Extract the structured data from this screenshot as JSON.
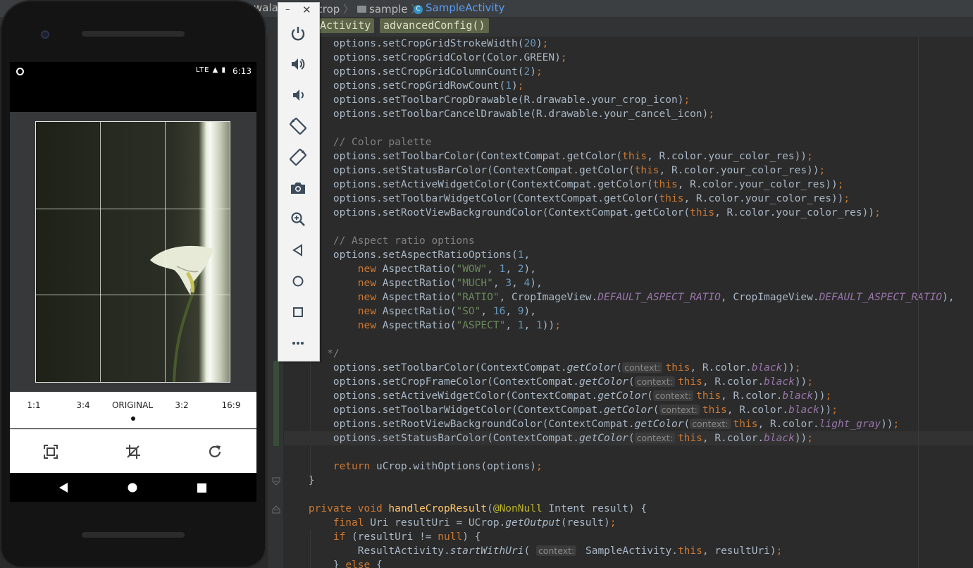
{
  "ide": {
    "breadcrumbs": {
      "path_fragment": "wala",
      "module": "ucrop",
      "folder": "sample",
      "class": "SampleActivity"
    },
    "code_context": {
      "class_chip": "eActivity",
      "method_chip": "advancedConfig()"
    },
    "code_lines": [
      {
        "t": "    options.setCropGridStrokeWidth(20);"
      },
      {
        "t": "    options.setCropGridColor(Color.GREEN);"
      },
      {
        "t": "    options.setCropGridColumnCount(2);"
      },
      {
        "t": "    options.setCropGridRowCount(1);"
      },
      {
        "t": "    options.setToolbarCropDrawable(R.drawable.your_crop_icon);"
      },
      {
        "t": "    options.setToolbarCancelDrawable(R.drawable.your_cancel_icon);"
      },
      {
        "t": ""
      },
      {
        "t": "    // Color palette"
      },
      {
        "t": "    options.setToolbarColor(ContextCompat.getColor(this, R.color.your_color_res));"
      },
      {
        "t": "    options.setStatusBarColor(ContextCompat.getColor(this, R.color.your_color_res));"
      },
      {
        "t": "    options.setActiveWidgetColor(ContextCompat.getColor(this, R.color.your_color_res));"
      },
      {
        "t": "    options.setToolbarWidgetColor(ContextCompat.getColor(this, R.color.your_color_res));"
      },
      {
        "t": "    options.setRootViewBackgroundColor(ContextCompat.getColor(this, R.color.your_color_res));"
      },
      {
        "t": ""
      },
      {
        "t": "    // Aspect ratio options"
      },
      {
        "t": "    options.setAspectRatioOptions(1,"
      },
      {
        "t": "        new AspectRatio(\"WOW\", 1, 2),"
      },
      {
        "t": "        new AspectRatio(\"MUCH\", 3, 4),"
      },
      {
        "t": "        new AspectRatio(\"RATIO\", CropImageView.DEFAULT_ASPECT_RATIO, CropImageView.DEFAULT_ASPECT_RATIO),"
      },
      {
        "t": "        new AspectRatio(\"SO\", 16, 9),"
      },
      {
        "t": "        new AspectRatio(\"ASPECT\", 1, 1));"
      },
      {
        "t": ""
      },
      {
        "t": "   */"
      },
      {
        "pre": "    options.setToolbarColor(ContextCompat.",
        "fn": "getColor",
        "mid": "(",
        "hint": "context:",
        "arg": "this",
        "post": ", R.color.",
        "fld": "black",
        "end": "));"
      },
      {
        "pre": "    options.setCropFrameColor(ContextCompat.",
        "fn": "getColor",
        "mid": "(",
        "hint": "context:",
        "arg": "this",
        "post": ", R.color.",
        "fld": "black",
        "end": "));"
      },
      {
        "pre": "    options.setActiveWidgetColor(ContextCompat.",
        "fn": "getColor",
        "mid": "(",
        "hint": "context:",
        "arg": "this",
        "post": ", R.color.",
        "fld": "black",
        "end": "));"
      },
      {
        "pre": "    options.setToolbarWidgetColor(ContextCompat.",
        "fn": "getColor",
        "mid": "(",
        "hint": "context:",
        "arg": "this",
        "post": ", R.color.",
        "fld": "black",
        "end": "));"
      },
      {
        "pre": "    options.setRootViewBackgroundColor(ContextCompat.",
        "fn": "getColor",
        "mid": "(",
        "hint": "context:",
        "arg": "this",
        "post": ", R.color.",
        "fld": "light_gray",
        "end": "));"
      },
      {
        "pre": "    options.setStatusBarColor(ContextCompat.",
        "fn": "getColor",
        "mid": "(",
        "hint": "context:",
        "arg": "this",
        "post": ", R.color.",
        "fld": "black",
        "end": "));"
      },
      {
        "t": ""
      },
      {
        "t": "    return uCrop.withOptions(options);"
      },
      {
        "t": "}"
      },
      {
        "t": ""
      },
      {
        "t": "private void handleCropResult(@NonNull Intent result) {"
      },
      {
        "t": "    final Uri resultUri = UCrop.getOutput(result);"
      },
      {
        "t": "    if (resultUri != null) {"
      },
      {
        "t": "        ResultActivity.startWithUri( context: SampleActivity.this, resultUri);"
      },
      {
        "t": "    } else {"
      }
    ]
  },
  "phone": {
    "status_time": "6:13",
    "status_icons": "LTE ▲ ▮",
    "aspect_ratios": [
      "1:1",
      "3:4",
      "ORIGINAL",
      "3:2",
      "16:9"
    ],
    "selected_ratio": "ORIGINAL",
    "tools": [
      "scale-icon",
      "crop-rotate-icon",
      "rotate-icon"
    ],
    "nav": [
      "back-icon",
      "home-icon",
      "recents-icon"
    ]
  },
  "emulator_panel": {
    "buttons": [
      "power-icon",
      "volume-up-icon",
      "volume-down-icon",
      "rotate-left-icon",
      "rotate-right-icon",
      "camera-icon",
      "zoom-icon",
      "back-icon",
      "home-icon",
      "overview-icon",
      "more-icon"
    ],
    "minimize": "–",
    "close": "✕"
  },
  "colors": {
    "editor_bg": "#2b2b2b",
    "keyword": "#cc7832",
    "string": "#6a8759",
    "number": "#6897bb",
    "field": "#9876aa",
    "function": "#ffc66d"
  }
}
